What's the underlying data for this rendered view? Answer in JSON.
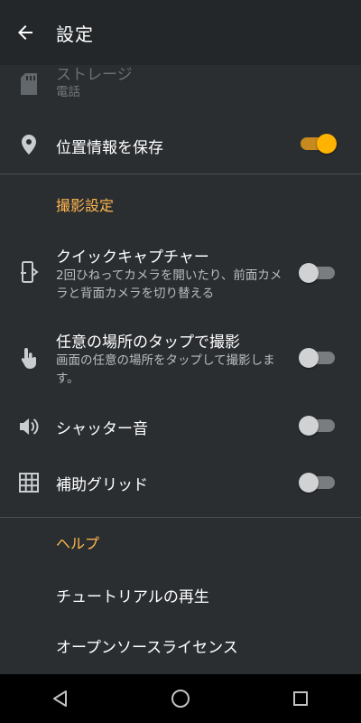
{
  "appbar": {
    "title": "設定",
    "back_icon": "arrow-left-icon"
  },
  "storage": {
    "title": "ストレージ",
    "summary": "電話",
    "icon": "sd-card-icon"
  },
  "location": {
    "title": "位置情報を保存",
    "icon": "location-pin-icon",
    "enabled": true
  },
  "capture_section": {
    "header": "撮影設定"
  },
  "quick_capture": {
    "title": "クイックキャプチャー",
    "summary": "2回ひねってカメラを開いたり、前面カメラと背面カメラを切り替える",
    "icon": "phone-twist-icon",
    "enabled": false
  },
  "tap_anywhere": {
    "title": "任意の場所のタップで撮影",
    "summary": "画面の任意の場所をタップして撮影します。",
    "icon": "touch-hand-icon",
    "enabled": false
  },
  "shutter_sound": {
    "title": "シャッター音",
    "icon": "speaker-icon",
    "enabled": false
  },
  "assist_grid": {
    "title": "補助グリッド",
    "icon": "grid-icon",
    "enabled": false
  },
  "help_section": {
    "header": "ヘルプ"
  },
  "help_items": [
    {
      "title": "チュートリアルの再生"
    },
    {
      "title": "オープンソースライセンス"
    }
  ],
  "navbar": {
    "back_icon": "nav-back-triangle-icon",
    "home_icon": "nav-home-circle-icon",
    "recents_icon": "nav-recents-square-icon"
  },
  "colors": {
    "accent": "#ffb300",
    "header_text": "#ffb74d",
    "background": "#2b2e31",
    "appbar": "#24272a"
  }
}
